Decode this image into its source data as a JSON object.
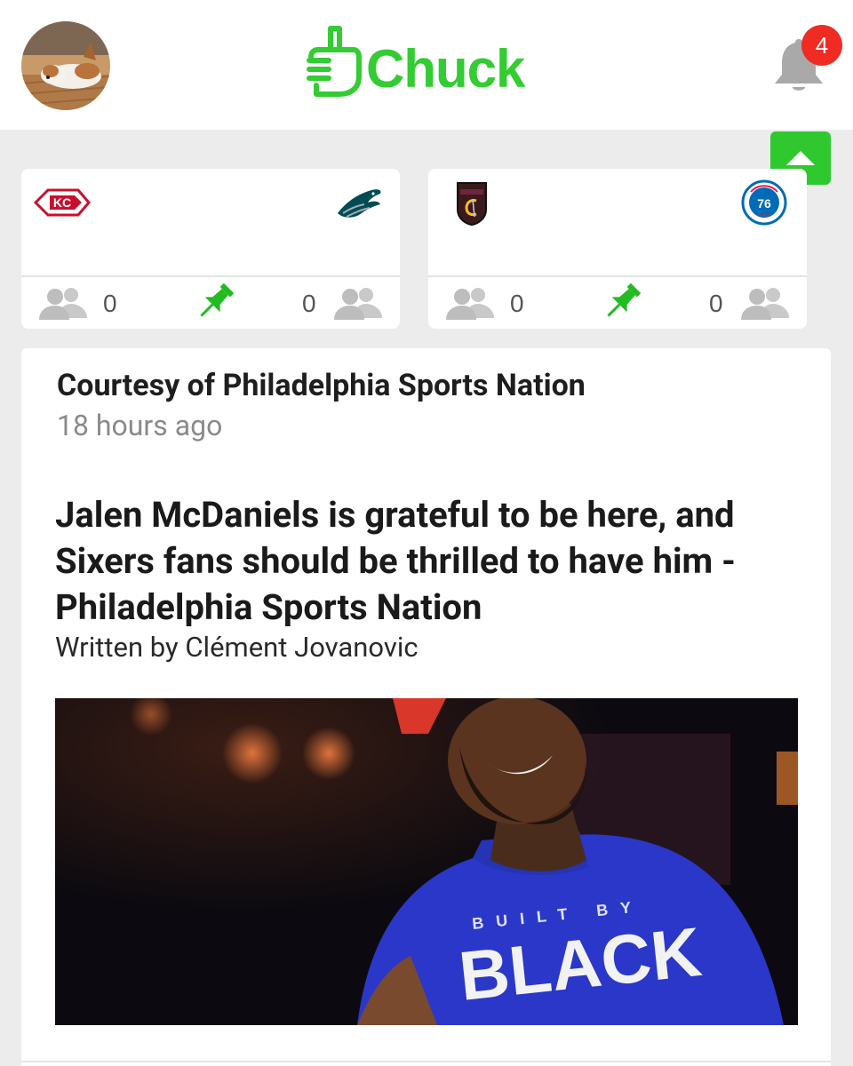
{
  "app": {
    "name": "Chuck"
  },
  "notifications": {
    "count": "4"
  },
  "icons": {
    "avatar": "dog-avatar",
    "logo": "raised-finger-hand-icon",
    "bell": "bell-icon",
    "scroll_top": "caret-up-icon",
    "fans": "people-icon",
    "pin": "pushpin-icon"
  },
  "colors": {
    "brand": "#33cc33",
    "badge": "#ef2b24",
    "pin": "#22bb22",
    "icon_gray": "#bdbdbd"
  },
  "matches": [
    {
      "home_team": "Kansas City Chiefs",
      "away_team": "Philadelphia Eagles",
      "home_fans": "0",
      "away_fans": "0"
    },
    {
      "home_team": "Cleveland Cavaliers",
      "away_team": "Philadelphia 76ers",
      "home_fans": "0",
      "away_fans": "0"
    }
  ],
  "article": {
    "source": "Courtesy of Philadelphia Sports Nation",
    "time_ago": "18 hours ago",
    "title": "Jalen McDaniels is grateful to be here, and Sixers fans should be thrilled to have him - Philadelphia Sports Nation",
    "author": "Written by Clément Jovanovic",
    "image_shirt_line1": "BUILT BY",
    "image_shirt_line2": "BLACK"
  }
}
